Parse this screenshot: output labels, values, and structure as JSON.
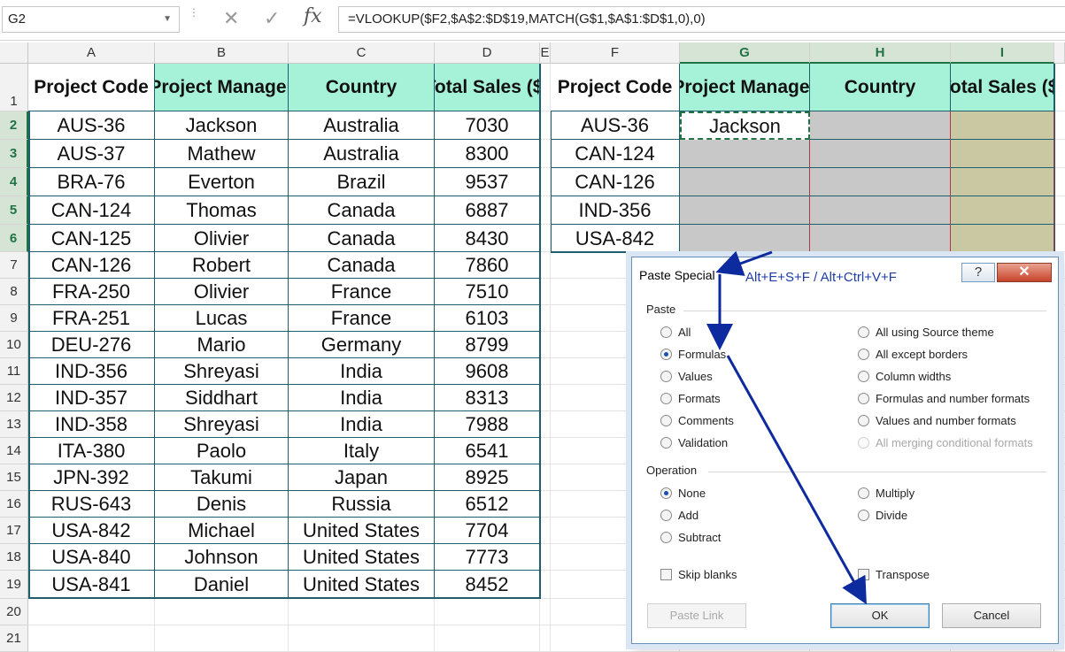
{
  "formula_bar": {
    "name_box": "G2",
    "cancel_glyph": "✕",
    "enter_glyph": "✓",
    "fx_label": "fx",
    "formula": "=VLOOKUP($F2,$A$2:$D$19,MATCH(G$1,$A$1:$D$1,0),0)"
  },
  "columns": [
    "A",
    "B",
    "C",
    "D",
    "E",
    "F",
    "G",
    "H",
    "I"
  ],
  "rows": [
    "1",
    "2",
    "3",
    "4",
    "5",
    "6",
    "7",
    "8",
    "9",
    "10",
    "11",
    "12",
    "13",
    "14",
    "15",
    "16",
    "17",
    "18",
    "19",
    "20",
    "21"
  ],
  "main_table": {
    "headers": [
      "Project Code",
      "Project Manager",
      "Country",
      "Total Sales ($)"
    ],
    "rows": [
      [
        "AUS-36",
        "Jackson",
        "Australia",
        "7030"
      ],
      [
        "AUS-37",
        "Mathew",
        "Australia",
        "8300"
      ],
      [
        "BRA-76",
        "Everton",
        "Brazil",
        "9537"
      ],
      [
        "CAN-124",
        "Thomas",
        "Canada",
        "6887"
      ],
      [
        "CAN-125",
        "Olivier",
        "Canada",
        "8430"
      ],
      [
        "CAN-126",
        "Robert",
        "Canada",
        "7860"
      ],
      [
        "FRA-250",
        "Olivier",
        "France",
        "7510"
      ],
      [
        "FRA-251",
        "Lucas",
        "France",
        "6103"
      ],
      [
        "DEU-276",
        "Mario",
        "Germany",
        "8799"
      ],
      [
        "IND-356",
        "Shreyasi",
        "India",
        "9608"
      ],
      [
        "IND-357",
        "Siddhart",
        "India",
        "8313"
      ],
      [
        "IND-358",
        "Shreyasi",
        "India",
        "7988"
      ],
      [
        "ITA-380",
        "Paolo",
        "Italy",
        "6541"
      ],
      [
        "JPN-392",
        "Takumi",
        "Japan",
        "8925"
      ],
      [
        "RUS-643",
        "Denis",
        "Russia",
        "6512"
      ],
      [
        "USA-842",
        "Michael",
        "United States",
        "7704"
      ],
      [
        "USA-840",
        "Johnson",
        "United States",
        "7773"
      ],
      [
        "USA-841",
        "Daniel",
        "United States",
        "8452"
      ]
    ]
  },
  "lookup_table": {
    "headers": [
      "Project Code",
      "Project Manager",
      "Country",
      "Total Sales ($)"
    ],
    "codes": [
      "AUS-36",
      "CAN-124",
      "CAN-126",
      "IND-356",
      "USA-842"
    ],
    "g2_value": "Jackson"
  },
  "dialog": {
    "title": "Paste Special",
    "shortcut": "Alt+E+S+F / Alt+Ctrl+V+F",
    "help": "?",
    "close": "✕",
    "paste_group": "Paste",
    "paste_left": [
      "All",
      "Formulas",
      "Values",
      "Formats",
      "Comments",
      "Validation"
    ],
    "paste_right": [
      "All using Source theme",
      "All except borders",
      "Column widths",
      "Formulas and number formats",
      "Values and number formats",
      "All merging conditional formats"
    ],
    "operation_group": "Operation",
    "op_left": [
      "None",
      "Add",
      "Subtract"
    ],
    "op_right": [
      "Multiply",
      "Divide"
    ],
    "skip_blanks": "Skip blanks",
    "transpose": "Transpose",
    "paste_link": "Paste Link",
    "ok": "OK",
    "cancel": "Cancel"
  },
  "colors": {
    "header_fill": "#a6f2d8",
    "selected_fill_gray": "#c8c8c8",
    "selected_fill_khaki": "#c9c8a2",
    "arrow": "#0d2a9e"
  }
}
